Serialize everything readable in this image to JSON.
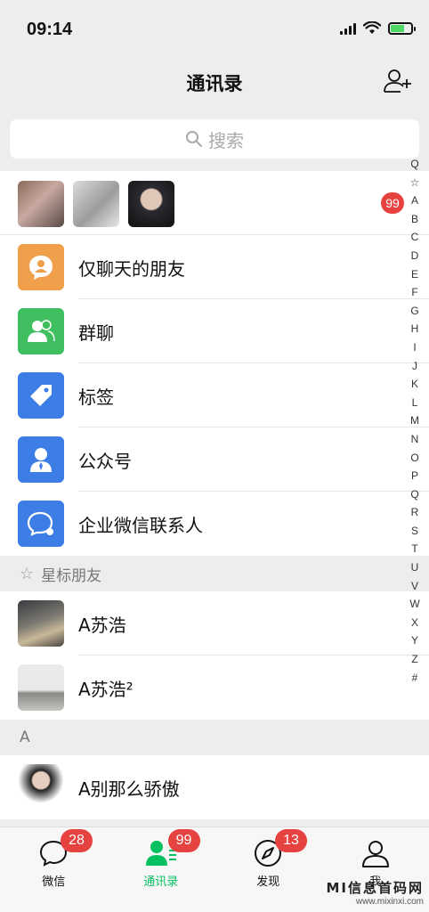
{
  "status_bar": {
    "time": "09:14"
  },
  "header": {
    "title": "通讯录"
  },
  "search": {
    "placeholder": "搜索"
  },
  "new_friends": {
    "badge": "99"
  },
  "menu_items": [
    {
      "label": "仅聊天的朋友",
      "color": "#f0a04b",
      "icon": "chat-only-icon"
    },
    {
      "label": "群聊",
      "color": "#3fbf5f",
      "icon": "group-icon"
    },
    {
      "label": "标签",
      "color": "#3d7de6",
      "icon": "tag-icon"
    },
    {
      "label": "公众号",
      "color": "#3d7de6",
      "icon": "official-account-icon"
    },
    {
      "label": "企业微信联系人",
      "color": "#3d7de6",
      "icon": "work-contact-icon"
    }
  ],
  "starred_section": {
    "title": "星标朋友"
  },
  "starred_contacts": [
    {
      "name": "A苏浩"
    },
    {
      "name": "A苏浩²"
    }
  ],
  "section_a": {
    "title": "A"
  },
  "a_contacts": [
    {
      "name": "A别那么骄傲"
    }
  ],
  "index_letters": [
    "Q",
    "☆",
    "A",
    "B",
    "C",
    "D",
    "E",
    "F",
    "G",
    "H",
    "I",
    "J",
    "K",
    "L",
    "M",
    "N",
    "O",
    "P",
    "Q",
    "R",
    "S",
    "T",
    "U",
    "V",
    "W",
    "X",
    "Y",
    "Z",
    "#"
  ],
  "tabs": [
    {
      "label": "微信",
      "badge": "28"
    },
    {
      "label": "通讯录",
      "badge": "99"
    },
    {
      "label": "发现",
      "badge": "13"
    },
    {
      "label": "我",
      "badge": ""
    }
  ],
  "watermark": {
    "title": "MI信息首码网",
    "url": "www.mixinxi.com"
  },
  "colors": {
    "accent": "#07c160",
    "badge": "#e64340"
  }
}
